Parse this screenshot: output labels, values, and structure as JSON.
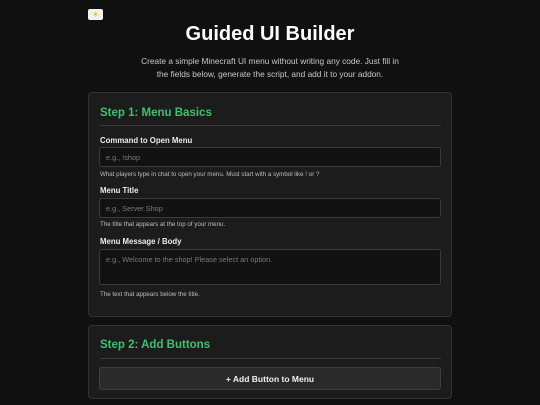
{
  "header": {
    "theme_icon": "sun-icon",
    "title": "Guided UI Builder",
    "intro": "Create a simple Minecraft UI menu without writing any code. Just fill in the fields below, generate the script, and add it to your addon."
  },
  "step1": {
    "title": "Step 1: Menu Basics",
    "command": {
      "label": "Command to Open Menu",
      "placeholder": "e.g., !shop",
      "value": "",
      "help": "What players type in chat to open your menu. Must start with a symbol like ! or ?"
    },
    "menu_title": {
      "label": "Menu Title",
      "placeholder": "e.g., Server Shop",
      "value": "",
      "help": "The title that appears at the top of your menu."
    },
    "body": {
      "label": "Menu Message / Body",
      "placeholder": "e.g., Welcome to the shop! Please select an option.",
      "value": "",
      "help": "The text that appears below the title."
    }
  },
  "step2": {
    "title": "Step 2: Add Buttons",
    "add_button_label": "+ Add Button to Menu"
  },
  "colors": {
    "accent": "#3ec06e",
    "background": "#101010",
    "card": "#1c1c1c"
  }
}
